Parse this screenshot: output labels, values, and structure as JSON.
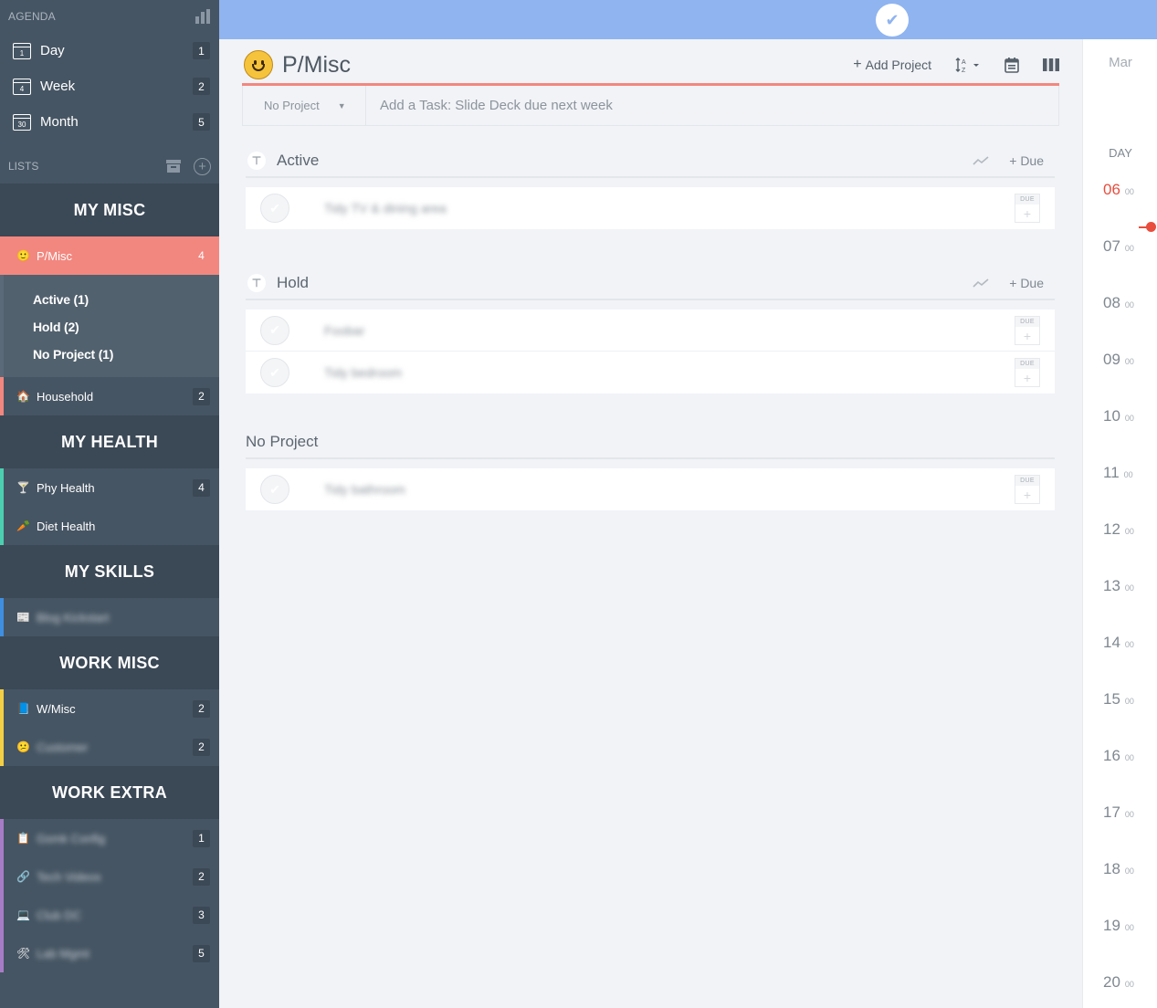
{
  "agenda": {
    "title": "AGENDA",
    "items": [
      {
        "label": "Day",
        "icon_num": "1",
        "count": "1"
      },
      {
        "label": "Week",
        "icon_num": "4",
        "count": "2"
      },
      {
        "label": "Month",
        "icon_num": "30",
        "count": "5"
      }
    ]
  },
  "lists": {
    "title": "LISTS"
  },
  "groups": [
    {
      "title": "MY MISC",
      "items": [
        {
          "emoji": "🙂",
          "label": "P/Misc",
          "count": "4"
        },
        {
          "emoji": "🏠",
          "label": "Household",
          "count": "2"
        }
      ],
      "sub": [
        "Active (1)",
        "Hold (2)",
        "No Project (1)"
      ]
    },
    {
      "title": "MY HEALTH",
      "items": [
        {
          "emoji": "🍸",
          "label": "Phy Health",
          "count": "4"
        },
        {
          "emoji": "🥕",
          "label": "Diet Health",
          "count": ""
        }
      ]
    },
    {
      "title": "MY SKILLS",
      "items": [
        {
          "emoji": "📰",
          "label": "Blog Kickstart",
          "count": ""
        }
      ]
    },
    {
      "title": "WORK MISC",
      "items": [
        {
          "emoji": "📘",
          "label": "W/Misc",
          "count": "2"
        },
        {
          "emoji": "😕",
          "label": "Customer",
          "count": "2"
        }
      ]
    },
    {
      "title": "WORK EXTRA",
      "items": [
        {
          "emoji": "📋",
          "label": "Gsmk Config",
          "count": "1"
        },
        {
          "emoji": "🔗",
          "label": "Tech Videos",
          "count": "2"
        },
        {
          "emoji": "💻",
          "label": "Club DC",
          "count": "3"
        },
        {
          "emoji": "🛠",
          "label": "Lab Mgmt",
          "count": "5"
        }
      ]
    }
  ],
  "header": {
    "title": "P/Misc",
    "add_project": "Add Project"
  },
  "add_task": {
    "project": "No Project",
    "placeholder": "Add a Task: Slide Deck due next week"
  },
  "sections": [
    {
      "name": "Active",
      "due": "+ Due",
      "tasks": [
        "Tidy TV & dining area"
      ]
    },
    {
      "name": "Hold",
      "due": "+ Due",
      "tasks": [
        "Foobar",
        "Tidy bedroom"
      ]
    },
    {
      "name": "No Project",
      "due": "",
      "tasks": [
        "Tidy bathroom"
      ]
    }
  ],
  "due_tag": "DUE",
  "calendar": {
    "month": "Mar",
    "view": "DAY",
    "hours": [
      "06",
      "07",
      "08",
      "09",
      "10",
      "11",
      "12",
      "13",
      "14",
      "15",
      "16",
      "17",
      "18",
      "19",
      "20"
    ],
    "minutes": "00",
    "current_hour": "06"
  },
  "colors": {
    "sidebar": "#465563",
    "accent": "#f2877f",
    "topbar": "#8fb4f0",
    "now": "#e84d3d"
  }
}
